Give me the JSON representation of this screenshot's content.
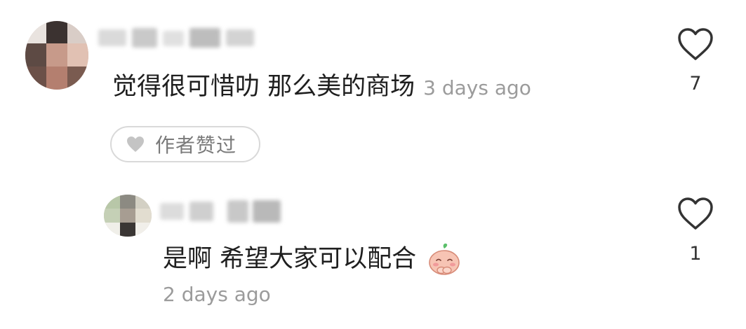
{
  "comment": {
    "text": "觉得很可惜叻 那么美的商场",
    "time": "3 days ago",
    "author_liked_label": "作者赞过",
    "like_count": "7"
  },
  "reply": {
    "text": "是啊 希望大家可以配合",
    "emoji": "sweet-bun-emoji",
    "time": "2 days ago",
    "like_count": "1"
  },
  "icons": {
    "like": "heart-outline-icon",
    "author_liked": "heart-filled-icon"
  },
  "colors": {
    "text": "#1f1f1f",
    "muted": "#9b9b9b",
    "pill_border": "#d9d9d9",
    "heart_stroke": "#333333",
    "heart_filled": "#c4c4c4"
  }
}
